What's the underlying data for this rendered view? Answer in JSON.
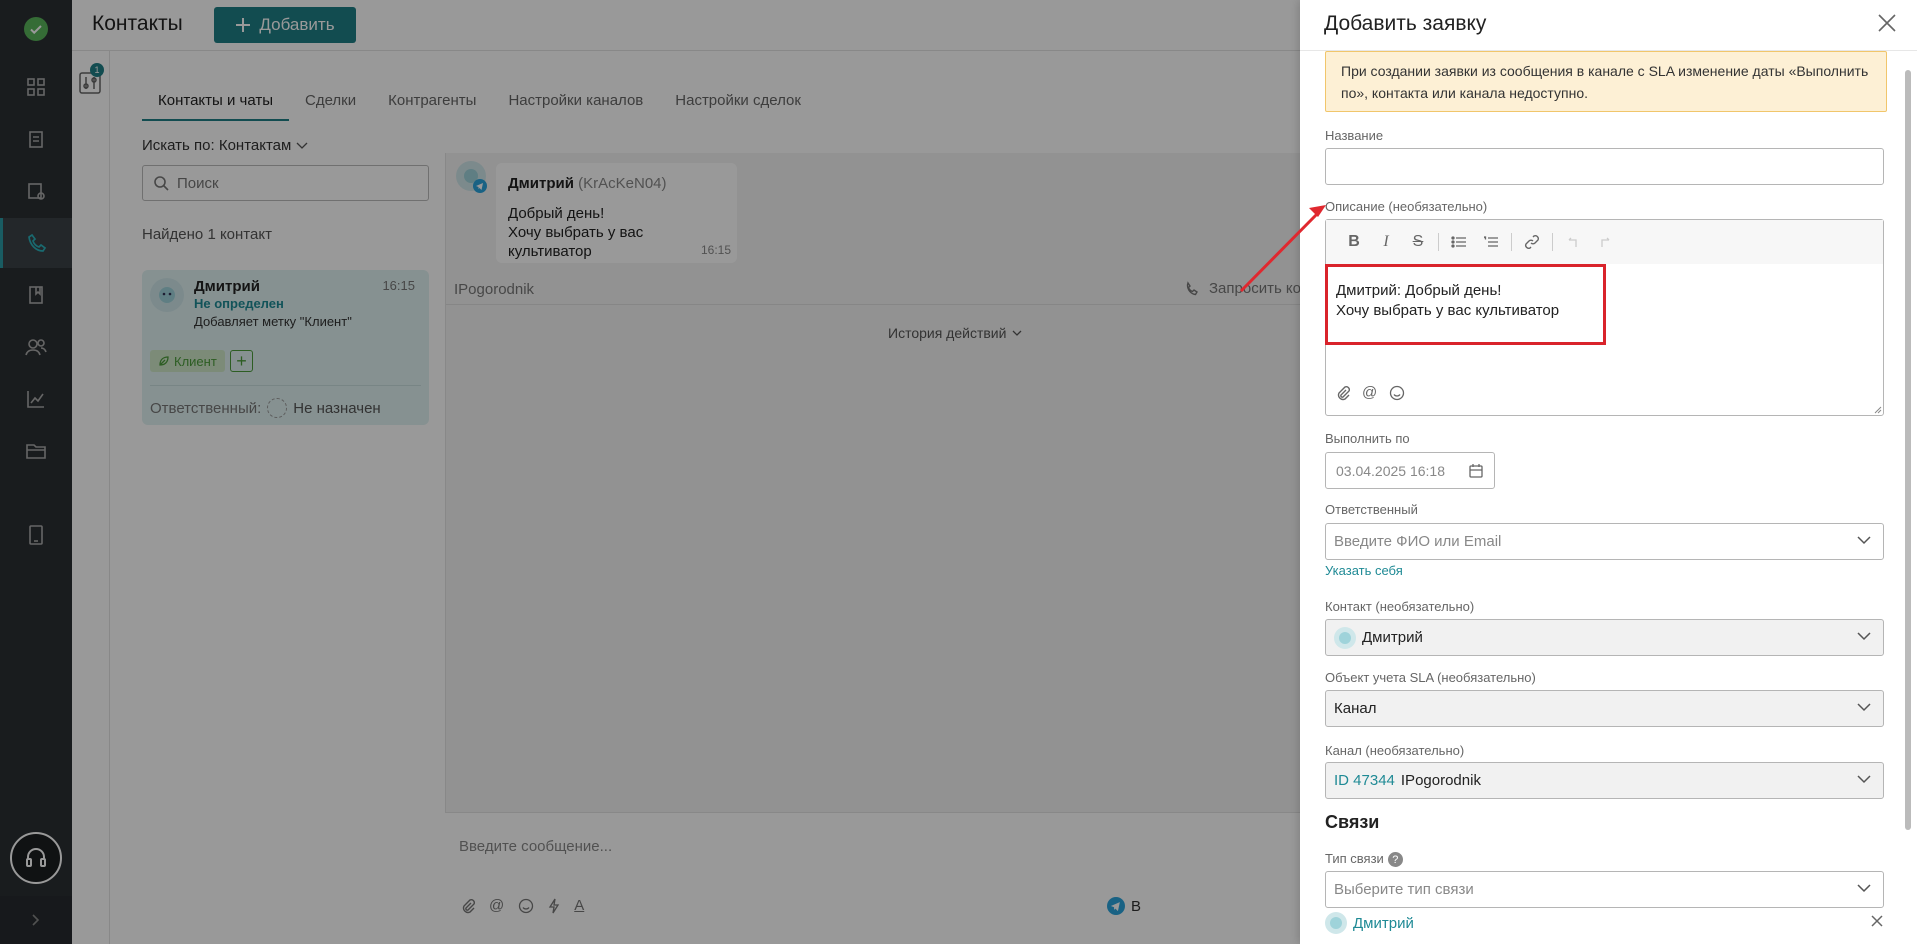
{
  "app": {
    "page_title": "Контакты",
    "add_label": "Добавить",
    "filter_badge": "1"
  },
  "tabs": [
    "Контакты и чаты",
    "Сделки",
    "Контрагенты",
    "Настройки каналов",
    "Настройки сделок"
  ],
  "search": {
    "by_label": "Искать по: Контактам",
    "placeholder": "Поиск"
  },
  "found_text": "Найдено 1 контакт",
  "contact_card": {
    "name": "Дмитрий",
    "status": "Не определен",
    "note": "Добавляет метку \"Клиент\"",
    "time": "16:15",
    "tag": "Клиент",
    "responsible_label": "Ответственный:",
    "responsible_value": "Не назначен"
  },
  "chat": {
    "author": "Дмитрий",
    "nick": "(KrAcKeN04)",
    "line1": "Добрый день!",
    "line2": "Хочу выбрать у вас культиватор",
    "time": "16:15",
    "channel": "IPogorodnik",
    "request_contact": "Запросить ко",
    "history": "История действий",
    "composer_placeholder": "Введите сообщение...",
    "send_chip": "В"
  },
  "panel": {
    "title": "Добавить заявку",
    "notice": "При создании заявки из сообщения в канале с SLA изменение даты «Выполнить по», контакта или канала недоступно.",
    "name_label": "Название",
    "name_value": "",
    "desc_label": "Описание (необязательно)",
    "desc_line1": "Дмитрий: Добрый день!",
    "desc_line2": "Хочу выбрать у вас культиватор",
    "due_label": "Выполнить по",
    "due_value": "03.04.2025 16:18",
    "resp_label": "Ответственный",
    "resp_placeholder": "Введите ФИО или Email",
    "assign_self": "Указать себя",
    "contact_label": "Контакт (необязательно)",
    "contact_value": "Дмитрий",
    "sla_label": "Объект учета SLA (необязательно)",
    "sla_value": "Канал",
    "channel_label": "Канал (необязательно)",
    "channel_id": "ID 47344",
    "channel_value": "IPogorodnik",
    "links_title": "Связи",
    "link_type_label": "Тип связи",
    "link_type_help": "?",
    "link_type_placeholder": "Выберите тип связи",
    "linked_contact": "Дмитрий"
  },
  "colors": {
    "accent": "#1f7f86",
    "rail": "#2b2f33",
    "highlight": "#d9232b",
    "notice_bg": "#fdf0d5"
  },
  "icons": [
    "check-logo-icon",
    "dashboard-icon",
    "tasks-icon",
    "reports-icon",
    "phone-icon",
    "book-icon",
    "users-icon",
    "chart-icon",
    "folder-icon",
    "tablet-icon",
    "headset-icon",
    "chevron-right-icon"
  ]
}
